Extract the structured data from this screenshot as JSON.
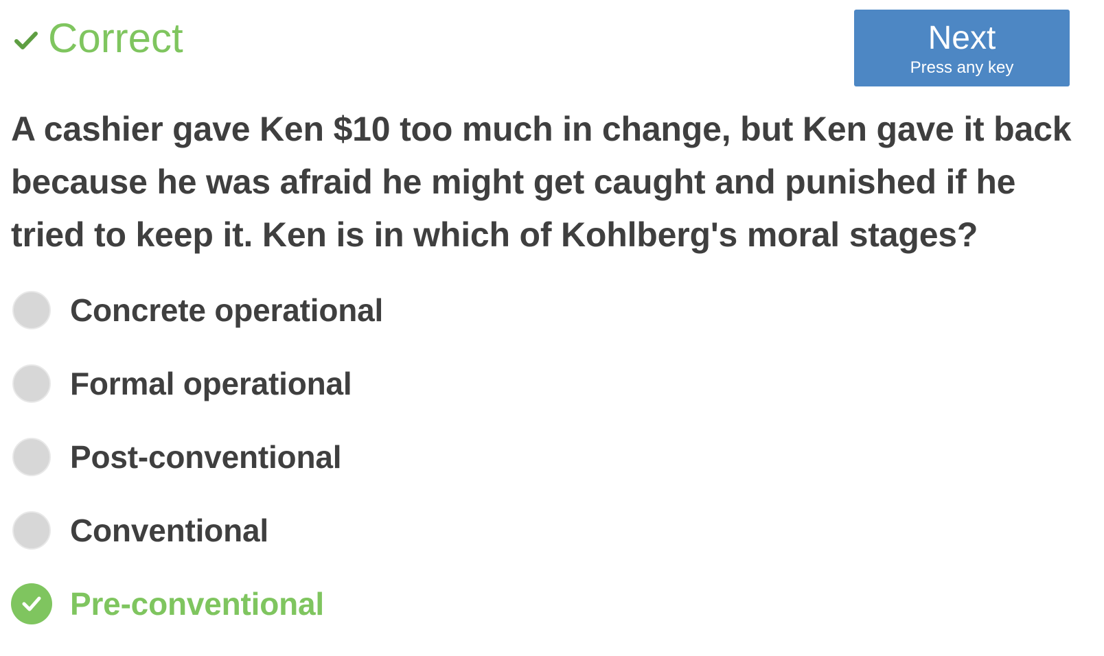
{
  "status": {
    "icon": "checkmark-icon",
    "label": "Correct",
    "color": "#7fc55f"
  },
  "next_button": {
    "label": "Next",
    "sublabel": "Press any key",
    "color": "#4d87c4"
  },
  "question": {
    "text": "A cashier gave Ken $10 too much in change, but Ken gave it back because he was afraid he might get caught and punished if he tried to keep it. Ken is in which of Kohlberg's moral stages?"
  },
  "options": [
    {
      "label": "Concrete operational",
      "state": "unselected"
    },
    {
      "label": "Formal operational",
      "state": "unselected"
    },
    {
      "label": "Post-conventional",
      "state": "unselected"
    },
    {
      "label": "Conventional",
      "state": "unselected"
    },
    {
      "label": "Pre-conventional",
      "state": "correct"
    }
  ]
}
